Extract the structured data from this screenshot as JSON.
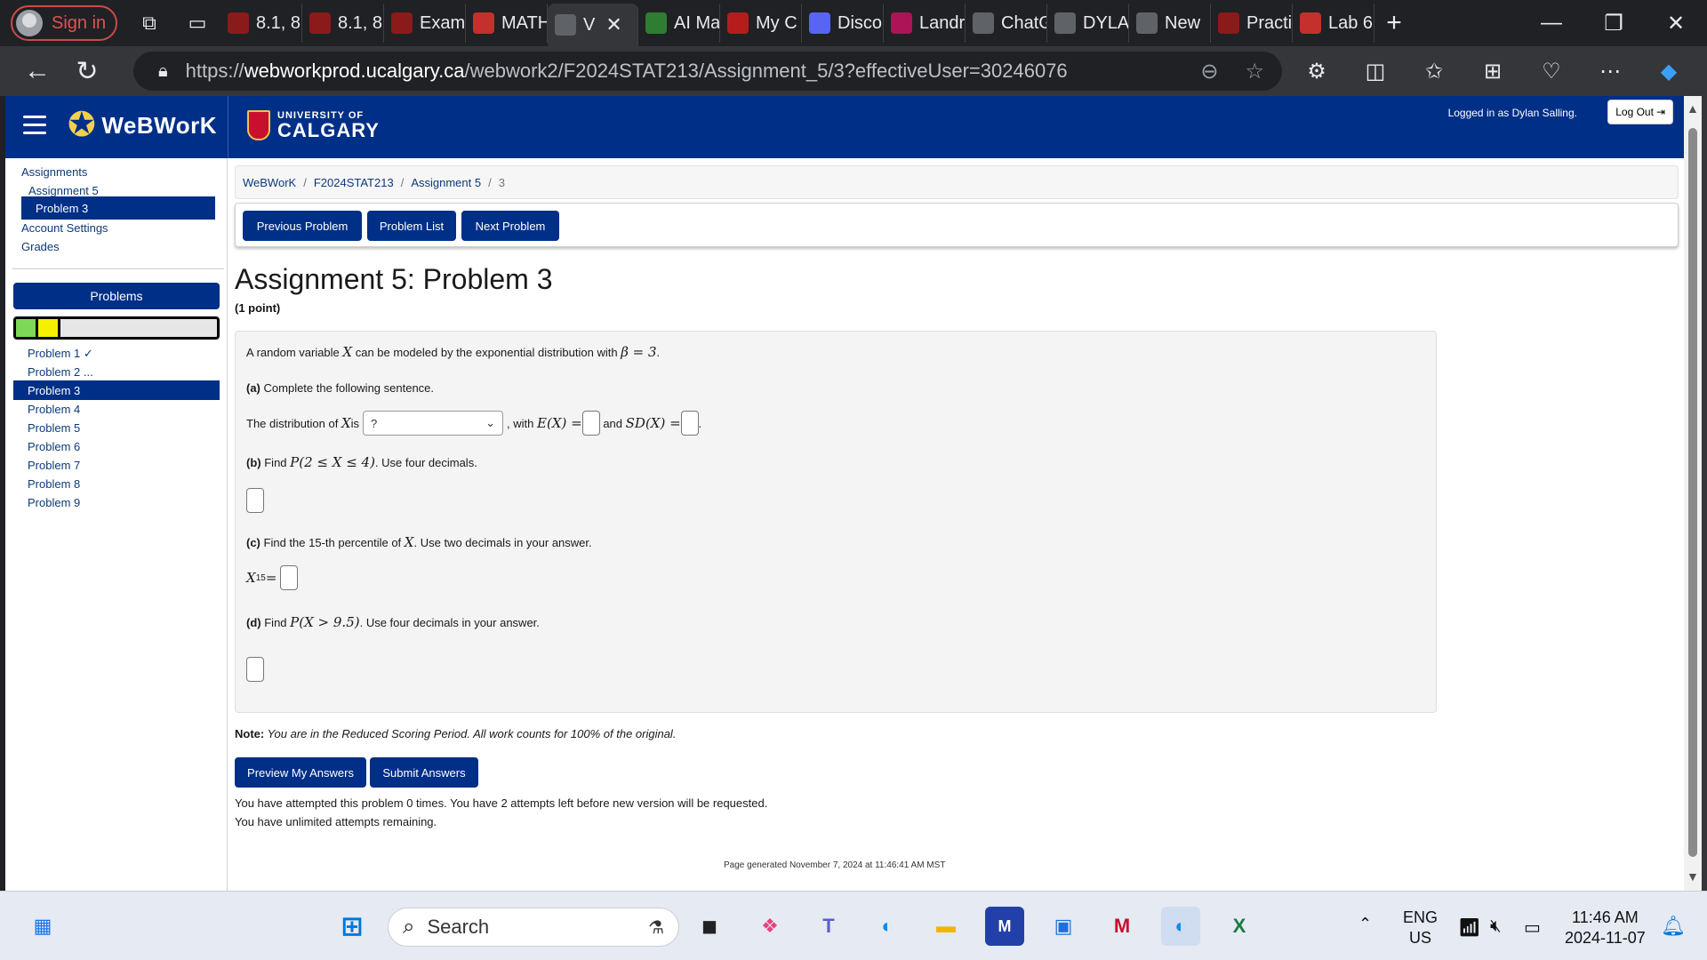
{
  "browser": {
    "profile_label": "Sign in",
    "tabs": [
      {
        "label": "8.1, 8",
        "color": "#8b1a1a"
      },
      {
        "label": "8.1, 8",
        "color": "#8b1a1a"
      },
      {
        "label": "Exam",
        "color": "#8b1a1a"
      },
      {
        "label": "MATH",
        "color": "#c4302b"
      },
      {
        "label": "V",
        "color": "#5f6368",
        "active": true
      },
      {
        "label": "AI Ma",
        "color": "#2e7d32"
      },
      {
        "label": "My C",
        "color": "#b71c1c"
      },
      {
        "label": "Disco",
        "color": "#5865f2"
      },
      {
        "label": "Landr",
        "color": "#ad1457"
      },
      {
        "label": "ChatG",
        "color": "#5f6368"
      },
      {
        "label": "DYLA",
        "color": "#5f6368"
      },
      {
        "label": "New",
        "color": "#5f6368"
      },
      {
        "label": "Practi",
        "color": "#8b1a1a"
      },
      {
        "label": "Lab 6",
        "color": "#c4302b"
      }
    ],
    "url_scheme": "https://",
    "url_host": "webworkprod.ucalgary.ca",
    "url_path": "/webwork2/F2024STAT213/Assignment_5/3?effectiveUser=30246076"
  },
  "header": {
    "app_name": "WeBWorK",
    "uni_line1": "UNIVERSITY OF",
    "uni_line2": "CALGARY",
    "login_text": "Logged in as Dylan Salling.",
    "logout_label": "Log Out"
  },
  "sidebar": {
    "assignments": "Assignments",
    "assignment": "Assignment 5",
    "problem": "Problem 3",
    "account": "Account Settings",
    "grades": "Grades",
    "problems_button": "Problems",
    "progress": [
      {
        "color": "#7ed957",
        "fraction": 0.111
      },
      {
        "color": "#f5f000",
        "fraction": 0.111
      }
    ],
    "problem_list": [
      {
        "label": "Problem 1 ✓"
      },
      {
        "label": "Problem 2 ..."
      },
      {
        "label": "Problem 3",
        "active": true
      },
      {
        "label": "Problem 4"
      },
      {
        "label": "Problem 5"
      },
      {
        "label": "Problem 6"
      },
      {
        "label": "Problem 7"
      },
      {
        "label": "Problem 8"
      },
      {
        "label": "Problem 9"
      }
    ]
  },
  "breadcrumb": [
    "WeBWorK",
    "F2024STAT213",
    "Assignment 5",
    "3"
  ],
  "nav_buttons": {
    "prev": "Previous Problem",
    "list": "Problem List",
    "next": "Next Problem"
  },
  "problem": {
    "title": "Assignment 5: Problem 3",
    "points": "(1 point)",
    "intro_pre": "A random variable ",
    "intro_var": "X",
    "intro_mid": " can be modeled by the exponential distribution with ",
    "intro_math": "β = 3",
    "intro_end": ".",
    "a_label": "(a)",
    "a_text": " Complete the following sentence.",
    "a_sentence_pre": "The distribution of ",
    "a_sentence_is": " is",
    "select_value": "?",
    "with": ", with ",
    "ex": "E(X) =",
    "and": "and ",
    "sdx": "SD(X) =",
    "b_label": "(b)",
    "b_find": " Find ",
    "b_math": "P(2 ≤ X ≤ 4)",
    "b_text": ". Use four decimals.",
    "c_label": "(c)",
    "c_text": " Find the 15-th percentile of ",
    "c_var": "X",
    "c_end": ". Use two decimals in your answer.",
    "c_x15": "X",
    "c_sub": "15",
    "c_eq": " =",
    "d_label": "(d)",
    "d_find": " Find ",
    "d_math": "P(X > 9.5)",
    "d_text": ". Use four decimals in your answer."
  },
  "note": {
    "label": "Note:",
    "text": " You are in the Reduced Scoring Period. All work counts for 100% of the original."
  },
  "actions": {
    "preview": "Preview My Answers",
    "submit": "Submit Answers"
  },
  "attempts": {
    "line1": "You have attempted this problem 0 times. You have 2 attempts left before new version will be requested.",
    "line2": "You have unlimited attempts remaining."
  },
  "footer": "Page generated November 7, 2024 at 11:46:41 AM MST",
  "taskbar": {
    "search_placeholder": "Search",
    "lang_top": "ENG",
    "lang_bottom": "US",
    "time": "11:46 AM",
    "date": "2024-11-07"
  }
}
